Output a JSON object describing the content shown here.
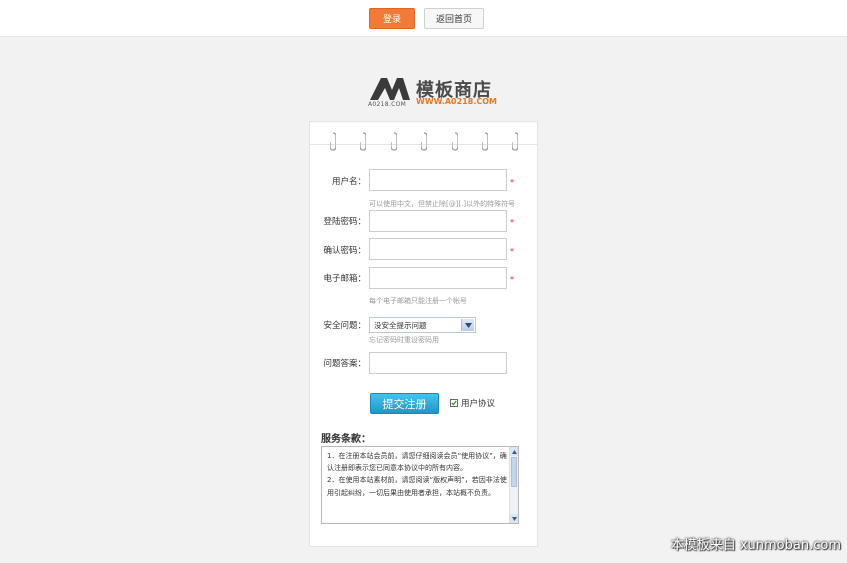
{
  "topbar": {
    "login_label": "登录",
    "home_label": "返回首页"
  },
  "logo": {
    "mark_text": "A0218.COM",
    "name": "模板商店",
    "url": "WWW.A0218.COM",
    "accent_color": "#e8791e"
  },
  "form": {
    "username": {
      "label": "用户名：",
      "value": "",
      "hint": "可以使用中文，但禁止除[@][.]以外的特殊符号"
    },
    "password": {
      "label": "登陆密码：",
      "value": ""
    },
    "confirm_password": {
      "label": "确认密码：",
      "value": ""
    },
    "email": {
      "label": "电子邮箱：",
      "value": "",
      "hint": "每个电子邮箱只能注册一个帐号"
    },
    "security_question": {
      "label": "安全问题：",
      "selected": "没安全提示问题",
      "hint": "忘记密码时重设密码用"
    },
    "answer": {
      "label": "问题答案：",
      "value": ""
    },
    "required_mark": "*",
    "submit_label": "提交注册",
    "agree_label": "用户协议",
    "agree_checked": true
  },
  "terms": {
    "title": "服务条款：",
    "lines": [
      "1．在注册本站会员前，请您仔细阅读会员“使用协议”，确认注册即表示您已同意本协议中的所有内容。",
      "2．在使用本站素材前，请您阅读“版权声明”，若因非法使用引起纠纷，一切后果由使用者承担，本站概不负责。"
    ]
  },
  "watermark": "本模板来自 xunmoban.com",
  "colors": {
    "login_button": "#f07a3a",
    "submit_button": "#1e97c8",
    "required": "#e02020"
  }
}
